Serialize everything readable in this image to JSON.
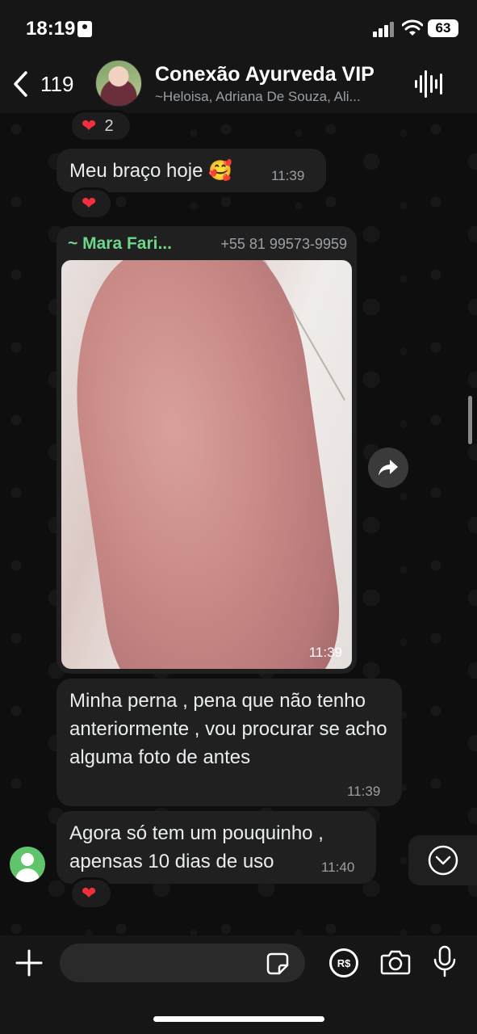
{
  "status_bar": {
    "time": "18:19",
    "battery": "63",
    "icons": [
      "id-card-icon",
      "cellular-signal-icon",
      "wifi-icon",
      "battery-icon"
    ]
  },
  "header": {
    "back_count": "119",
    "title": "Conexão Ayurveda VIP",
    "subtitle": "~Heloisa, Adriana De Souza, Ali..."
  },
  "messages": [
    {
      "id": "reaction-top",
      "reaction": {
        "emoji": "❤️",
        "count": "2"
      }
    },
    {
      "id": "msg-1",
      "text": "Meu braço hoje 🥰",
      "time": "11:39",
      "reaction": {
        "emoji": "❤️"
      }
    },
    {
      "id": "msg-2",
      "sender_name": "~ Mara Fari...",
      "sender_phone": "+55 81 99573-9959",
      "media": "photo",
      "time": "11:39"
    },
    {
      "id": "msg-3",
      "text": "Minha perna , pena que não tenho anteriormente , vou procurar se acho alguma foto de antes",
      "time": "11:39"
    },
    {
      "id": "msg-4",
      "text": "Agora só tem um pouquinho , apensas 10 dias de uso",
      "time": "11:40",
      "reaction": {
        "emoji": "❤️"
      }
    }
  ],
  "composer": {
    "placeholder": "",
    "pix_label": "R$"
  },
  "colors": {
    "background": "#0b0b0b",
    "bubble": "#202020",
    "sender_name": "#6ed68a",
    "heart": "#f32f3c",
    "meta_text": "#9aa0a6"
  }
}
